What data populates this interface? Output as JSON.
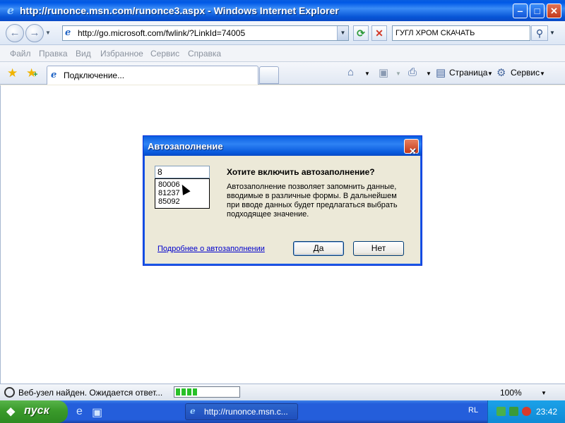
{
  "window": {
    "title": "http://runonce.msn.com/runonce3.aspx - Windows Internet Explorer",
    "minimize": "‒",
    "maximize": "□",
    "close": "✕"
  },
  "address_bar": {
    "url": "http://go.microsoft.com/fwlink/?LinkId=74005",
    "search_text": "ГУГЛ ХРОМ СКАЧАТЬ"
  },
  "menu": [
    "Файл",
    "Правка",
    "Вид",
    "Избранное",
    "Сервис",
    "Справка"
  ],
  "tab": {
    "label": "Подключение..."
  },
  "command_bar": {
    "page": "Страница",
    "tools": "Сервис"
  },
  "dialog": {
    "title": "Автозаполнение",
    "input_value": "8",
    "suggestions": [
      "80006",
      "81237",
      "85092"
    ],
    "heading": "Хотите включить автозаполнение?",
    "description": "Автозаполнение позволяет запомнить данные, вводимые в различные формы. В дальнейшем при вводе данных будет предлагаться выбрать подходящее значение.",
    "link": "Подробнее о автозаполнении",
    "yes_label": "Да",
    "no_label": "Нет"
  },
  "status": {
    "text": "Веб-узел найден. Ожидается ответ...",
    "progress": 0.35,
    "zoom": "100%"
  },
  "taskbar": {
    "start_label": "пуск",
    "task_label": "http://runonce.msn.c...",
    "lang": "RL",
    "clock": "23:42"
  },
  "colors": {
    "title_blue": "#0a5ee0",
    "link_blue": "#0000cc",
    "progress_green": "#28c028",
    "start_green": "#3a9a2b"
  }
}
